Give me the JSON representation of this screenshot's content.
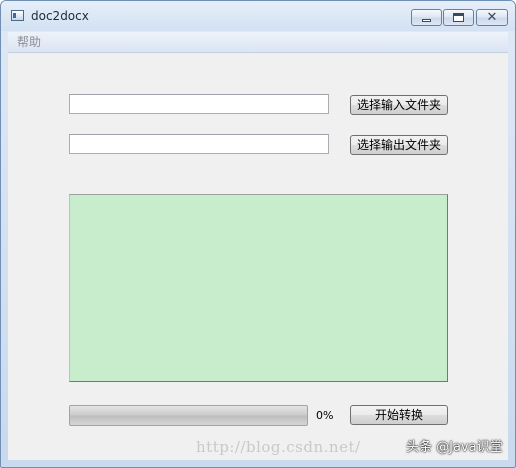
{
  "window": {
    "title": "doc2docx",
    "icon": "app-window-icon",
    "controls": {
      "minimize_icon": "minimize-icon",
      "maximize_icon": "maximize-icon",
      "close_icon": "close-icon",
      "close_glyph": "✕"
    }
  },
  "menubar": {
    "items": [
      {
        "label": "帮助"
      }
    ]
  },
  "form": {
    "input_folder": {
      "value": "",
      "placeholder": "",
      "button_label": "选择输入文件夹"
    },
    "output_folder": {
      "value": "",
      "placeholder": "",
      "button_label": "选择输出文件夹"
    },
    "log": {
      "value": ""
    },
    "progress": {
      "value": 0,
      "label": "0%"
    },
    "start_button_label": "开始转换"
  },
  "watermark": {
    "url_text": "http://blog.csdn.net/",
    "badge_text": "头条 @Java识堂"
  },
  "colors": {
    "log_background": "#c7edcc",
    "client_background": "#f0f0f0",
    "titlebar_gradient_top": "#e6eff9",
    "titlebar_gradient_bottom": "#d3e1f3",
    "progress_fill": "#37c21f"
  }
}
